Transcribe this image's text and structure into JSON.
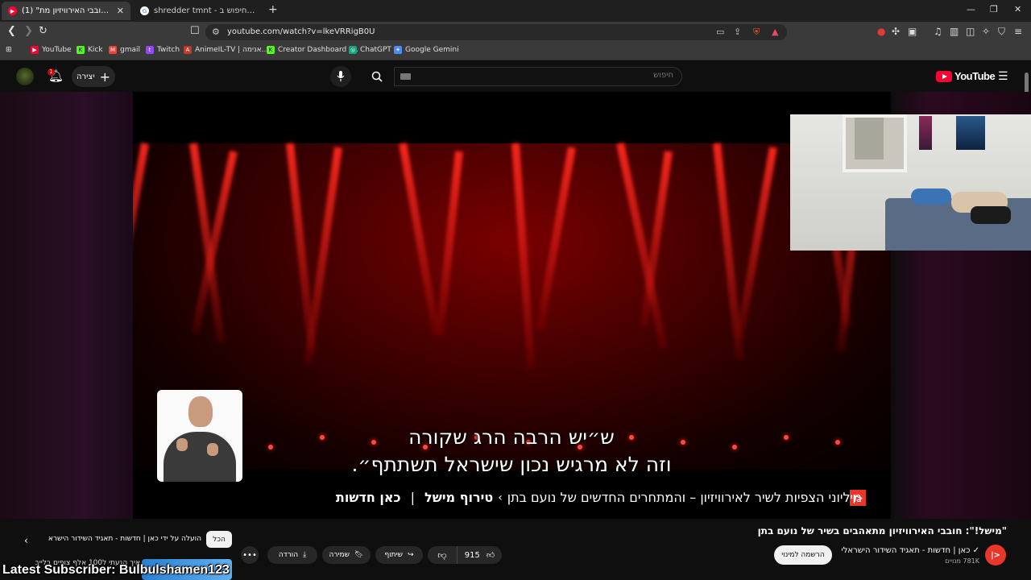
{
  "browser": {
    "tabs": [
      {
        "title": "(1) \"מישל!\": חובבי האירוויזיון מת",
        "close": "✕"
      },
      {
        "title": "shredder tmnt - חיפוש ב-Google",
        "close": ""
      }
    ],
    "new_tab": "+",
    "url": "youtube.com/watch?v=lkeVRRigB0U",
    "bookmarks": [
      {
        "label": "YouTube",
        "color": "#ff0033",
        "glyph": "▶"
      },
      {
        "label": "Kick",
        "color": "#53fc18",
        "glyph": "K"
      },
      {
        "label": "gmail",
        "color": "#ea4335",
        "glyph": "M"
      },
      {
        "label": "Twitch",
        "color": "#9146ff",
        "glyph": "t"
      },
      {
        "label": "AnimeIL-TV | אנימה...",
        "color": "#c0392b",
        "glyph": "A"
      },
      {
        "label": "Creator Dashboard |...",
        "color": "#53fc18",
        "glyph": "K"
      },
      {
        "label": "ChatGPT",
        "color": "#10a37f",
        "glyph": "◎"
      },
      {
        "label": "Google Gemini",
        "color": "#4c8bf5",
        "glyph": "✦"
      }
    ]
  },
  "youtube": {
    "logo_text": "YouTube",
    "search_placeholder": "חיפוש",
    "create_label": "יצירה",
    "notification_count": "1",
    "accent_color": "#ff0033"
  },
  "video": {
    "subtitle_line1": "ש״יש הרבה הרג שקורה",
    "subtitle_line2": "וזה לא מרגיש נכון שישראל תשתתף״.",
    "ticker_brand": "כאן חדשות",
    "ticker_sep": "|",
    "ticker_topic": "טירוף מישל",
    "ticker_chevron": "›",
    "ticker_headline": "מיליוני הצפיות לשיר לאירוויזיון – והמתחרים החדשים של נועם בתן",
    "ticker_logo": "|>"
  },
  "meta": {
    "title": "\"מישל!\": חובבי האירוויזיון מתאהבים בשיר של נועם בתן",
    "channel_name": "כאן | חדשות - תאגיד השידור הישראלי",
    "subscribers": "781K מנויים",
    "subscribe_label": "הרשמה למינוי",
    "likes": "915",
    "share_label": "שיתוף",
    "save_label": "שמירה",
    "download_label": "הורדה",
    "more_label": "•••"
  },
  "sidebar": {
    "chip_all": "הכל",
    "chip_uploaded": "הועלה על ידי כאן | חדשות - תאגיד השידור הישראלי",
    "rec_title": "איך הגעתי ל100 אלף צופים בלייב"
  },
  "overlay": {
    "stream_text": "Latest Subscriber: Bulbulshamen123"
  }
}
